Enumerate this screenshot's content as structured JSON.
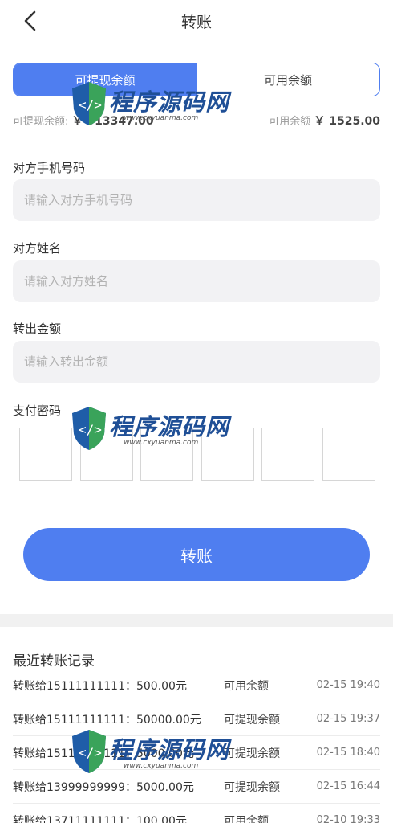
{
  "header": {
    "title": "转账",
    "back_icon": "chevron-left-icon"
  },
  "segment": {
    "tab_withdrawable": "可提现余额",
    "tab_available": "可用余额",
    "accent": "#4f7ef0"
  },
  "balances": {
    "withdrawable_label": "可提现余额:",
    "withdrawable_value": "￥ 913347.00",
    "available_label": "可用余额",
    "available_value": "￥ 1525.00"
  },
  "form": {
    "phone_label": "对方手机号码",
    "phone_placeholder": "请输入对方手机号码",
    "name_label": "对方姓名",
    "name_placeholder": "请输入对方姓名",
    "amount_label": "转出金额",
    "amount_placeholder": "请输入转出金额",
    "password_label": "支付密码"
  },
  "submit_label": "转账",
  "records": {
    "title": "最近转账记录",
    "items": [
      {
        "text": "转账给15111111111：500.00元",
        "type": "可用余额",
        "time": "02-15 19:40"
      },
      {
        "text": "转账给15111111111：50000.00元",
        "type": "可提现余额",
        "time": "02-15 19:37"
      },
      {
        "text": "转账给15111111111：5000.00元",
        "type": "可提现余额",
        "time": "02-15 18:40"
      },
      {
        "text": "转账给13999999999：5000.00元",
        "type": "可提现余额",
        "time": "02-15 16:44"
      },
      {
        "text": "转账给13711111111：100.00元",
        "type": "可用余额",
        "time": "02-10 19:33"
      }
    ]
  },
  "watermark": {
    "brand": "程序源码网",
    "url": "www.cxyuanma.com"
  }
}
